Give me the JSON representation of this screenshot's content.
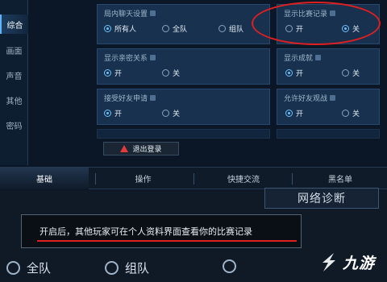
{
  "sidebar": {
    "items": [
      {
        "label": "综合",
        "active": true
      },
      {
        "label": "画面",
        "active": false
      },
      {
        "label": "声音",
        "active": false
      },
      {
        "label": "其他",
        "active": false
      },
      {
        "label": "密码",
        "active": false
      }
    ]
  },
  "settings": {
    "chat": {
      "title": "局内聊天设置",
      "options": [
        "所有人",
        "全队",
        "组队"
      ],
      "selected": "所有人"
    },
    "show_record": {
      "title": "显示比赛记录",
      "options": [
        "开",
        "关"
      ],
      "selected": "关"
    },
    "show_close": {
      "title": "显示亲密关系",
      "options": [
        "开",
        "关"
      ],
      "selected": "开"
    },
    "show_achievement": {
      "title": "显示成就",
      "options": [
        "开",
        "关"
      ],
      "selected": "开"
    },
    "friend_request": {
      "title": "接受好友申请",
      "options": [
        "开",
        "关"
      ],
      "selected": "开"
    },
    "allow_watch": {
      "title": "允许好友观战",
      "options": [
        "开",
        "关"
      ],
      "selected": "开"
    }
  },
  "logout": {
    "label": "退出登录",
    "icon": "warning-icon"
  },
  "tabs": [
    {
      "label": "基础",
      "active": true
    },
    {
      "label": "操作",
      "active": false
    },
    {
      "label": "快捷交流",
      "active": false
    },
    {
      "label": "黑名单",
      "active": false
    }
  ],
  "net_diagnose": {
    "label": "网络诊断"
  },
  "tooltip": {
    "text": "开启后，其他玩家可在个人资料界面查看你的比赛记录"
  },
  "lower_options": [
    "全队",
    "组队"
  ],
  "watermark": {
    "text": "九游"
  },
  "colors": {
    "highlight": "#e02020",
    "accent": "#6fc2ff",
    "panel": "#17314e"
  }
}
